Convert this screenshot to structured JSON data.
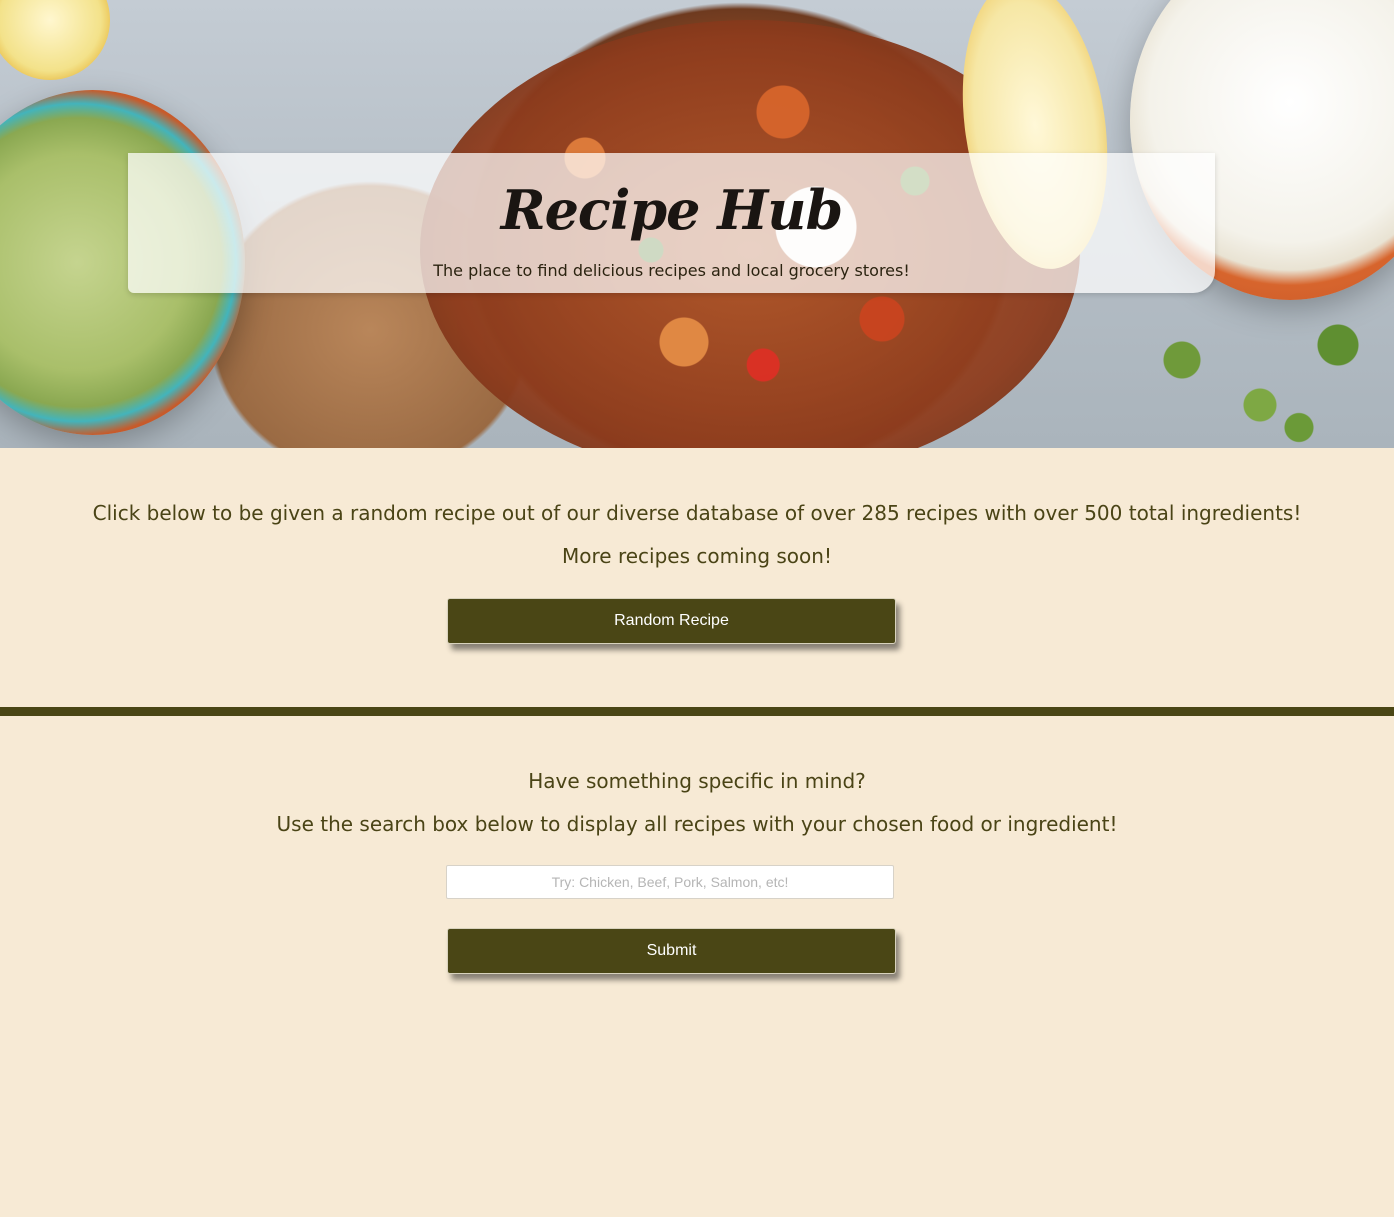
{
  "header": {
    "title": "Recipe Hub",
    "tagline": "The place to find delicious recipes and local grocery stores!"
  },
  "random_section": {
    "intro": "Click below to be given a random recipe out of our diverse database of over 285 recipes with over 500 total ingredients!",
    "coming_soon": "More recipes coming soon!",
    "button_label": "Random Recipe"
  },
  "search_section": {
    "prompt": "Have something specific in mind?",
    "instructions": "Use the search box below to display all recipes with your chosen food or ingredient!",
    "input_value": "",
    "input_placeholder": "Try: Chicken, Beef, Pork, Salmon, etc!",
    "submit_label": "Submit"
  },
  "colors": {
    "background": "#f7ead5",
    "accent": "#4a4615",
    "text": "#4a4416"
  }
}
